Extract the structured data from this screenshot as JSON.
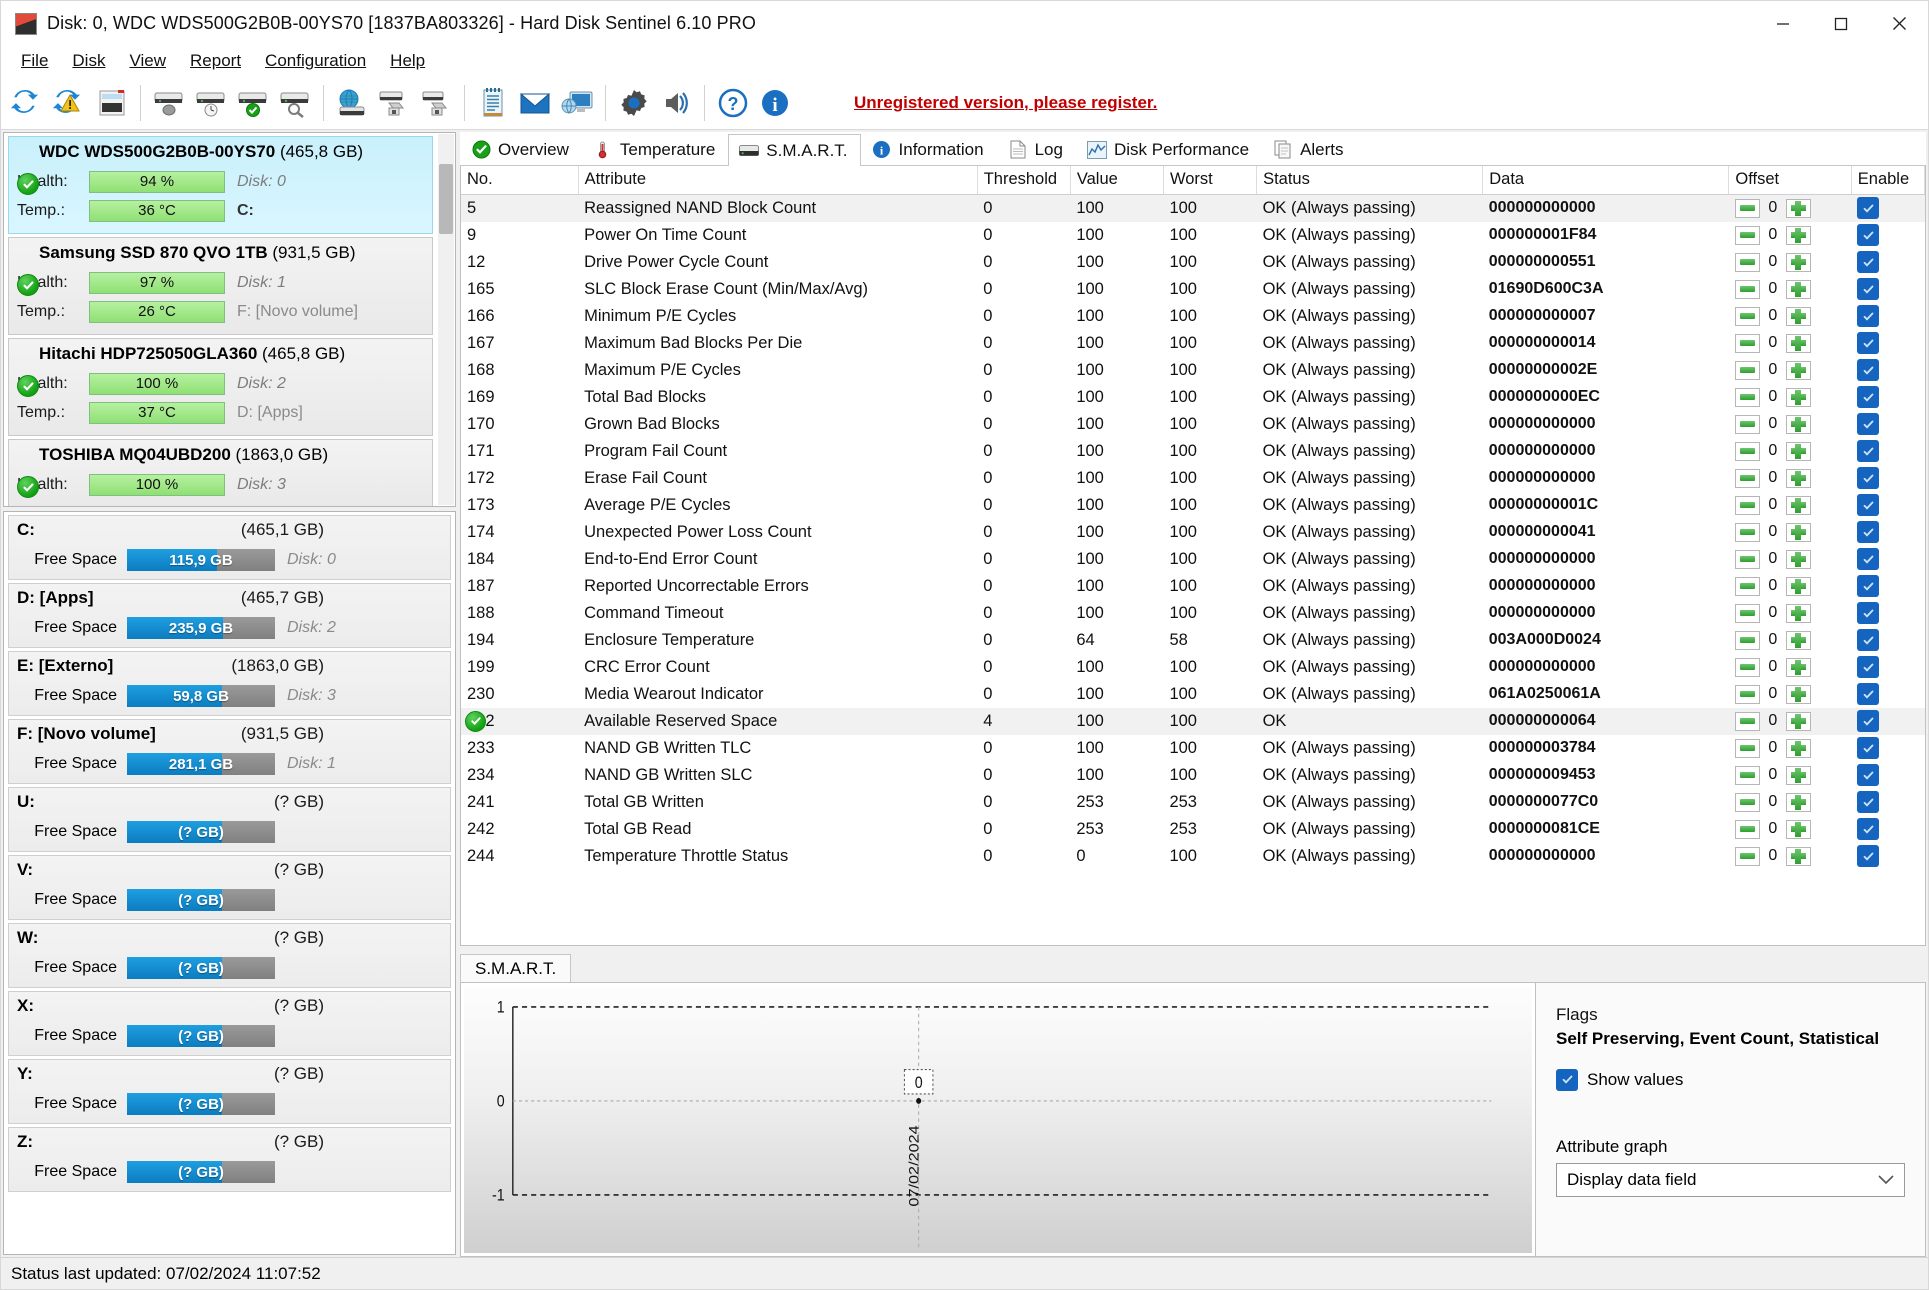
{
  "window": {
    "title": "Disk: 0, WDC WDS500G2B0B-00YS70 [1837BA803326]  -  Hard Disk Sentinel 6.10 PRO",
    "minimize": "—",
    "maximize": "□",
    "close": "✕"
  },
  "menu": [
    {
      "label": "File"
    },
    {
      "label": "Disk"
    },
    {
      "label": "View"
    },
    {
      "label": "Report"
    },
    {
      "label": "Configuration"
    },
    {
      "label": "Help"
    }
  ],
  "toolbar": {
    "registration_notice": "Unregistered version, please register.",
    "buttons": [
      {
        "name": "refresh-icon",
        "title": "Refresh"
      },
      {
        "name": "refresh-warning-icon",
        "title": "Refresh with alert"
      },
      {
        "name": "disk-report-icon",
        "title": "Report"
      },
      {
        "name": "disk-acoustic-icon",
        "title": "Acoustic management"
      },
      {
        "name": "disk-power-icon",
        "title": "Power management"
      },
      {
        "name": "disk-check-icon",
        "title": "Disk check"
      },
      {
        "name": "disk-search-icon",
        "title": "Surface test"
      },
      {
        "name": "network-disk-icon",
        "title": "Network disks"
      },
      {
        "name": "disk-backup-icon",
        "title": "Backup"
      },
      {
        "name": "disk-clone-icon",
        "title": "Clone"
      },
      {
        "name": "notepad-icon",
        "title": "Text report"
      },
      {
        "name": "email-icon",
        "title": "Send e-mail"
      },
      {
        "name": "remote-monitor-icon",
        "title": "Remote monitoring"
      },
      {
        "name": "gear-icon",
        "title": "Configuration"
      },
      {
        "name": "alert-sound-icon",
        "title": "Alerts"
      },
      {
        "name": "help-icon",
        "title": "Help"
      },
      {
        "name": "info-icon",
        "title": "Information"
      }
    ]
  },
  "disks": [
    {
      "name": "WDC WDS500G2B0B-00YS70",
      "capacity": "(465,8 GB)",
      "health_label": "Health:",
      "health_value": "94 %",
      "temp_label": "Temp.:",
      "temp_value": "36 °C",
      "disk_no": "Disk: 0",
      "volumes": "C:",
      "selected": true
    },
    {
      "name": "Samsung SSD 870 QVO 1TB",
      "capacity": "(931,5 GB)",
      "health_label": "Health:",
      "health_value": "97 %",
      "temp_label": "Temp.:",
      "temp_value": "26 °C",
      "disk_no": "Disk: 1",
      "volumes": "F: [Novo volume]",
      "selected": false
    },
    {
      "name": "Hitachi HDP725050GLA360",
      "capacity": "(465,8 GB)",
      "health_label": "Health:",
      "health_value": "100 %",
      "temp_label": "Temp.:",
      "temp_value": "37 °C",
      "disk_no": "Disk: 2",
      "volumes": "D: [Apps]",
      "selected": false
    },
    {
      "name": "TOSHIBA MQ04UBD200",
      "capacity": "(1863,0 GB)",
      "health_label": "Health:",
      "health_value": "100 %",
      "temp_label": "",
      "temp_value": "",
      "disk_no": "Disk: 3",
      "volumes": "",
      "selected": false
    }
  ],
  "volumes": [
    {
      "letter": "C:",
      "size": "(465,1 GB)",
      "free_label": "Free Space",
      "free": "115,9 GB",
      "pct": 61,
      "disk": "Disk: 0"
    },
    {
      "letter": "D: [Apps]",
      "size": "(465,7 GB)",
      "free_label": "Free Space",
      "free": "235,9 GB",
      "pct": 65,
      "disk": "Disk: 2"
    },
    {
      "letter": "E: [Externo]",
      "size": "(1863,0 GB)",
      "free_label": "Free Space",
      "free": "59,8 GB",
      "pct": 64,
      "disk": "Disk: 3"
    },
    {
      "letter": "F: [Novo volume]",
      "size": "(931,5 GB)",
      "free_label": "Free Space",
      "free": "281,1 GB",
      "pct": 64,
      "disk": "Disk: 1"
    },
    {
      "letter": "U:",
      "size": "(? GB)",
      "free_label": "Free Space",
      "free": "(? GB)",
      "pct": 64,
      "disk": ""
    },
    {
      "letter": "V:",
      "size": "(? GB)",
      "free_label": "Free Space",
      "free": "(? GB)",
      "pct": 64,
      "disk": ""
    },
    {
      "letter": "W:",
      "size": "(? GB)",
      "free_label": "Free Space",
      "free": "(? GB)",
      "pct": 64,
      "disk": ""
    },
    {
      "letter": "X:",
      "size": "(? GB)",
      "free_label": "Free Space",
      "free": "(? GB)",
      "pct": 64,
      "disk": ""
    },
    {
      "letter": "Y:",
      "size": "(? GB)",
      "free_label": "Free Space",
      "free": "(? GB)",
      "pct": 64,
      "disk": ""
    },
    {
      "letter": "Z:",
      "size": "(? GB)",
      "free_label": "Free Space",
      "free": "(? GB)",
      "pct": 64,
      "disk": ""
    }
  ],
  "tabs": [
    {
      "label": "Overview",
      "icon": "check-circle-icon",
      "active": false
    },
    {
      "label": "Temperature",
      "icon": "thermometer-icon",
      "active": false
    },
    {
      "label": "S.M.A.R.T.",
      "icon": "disk-icon",
      "active": true
    },
    {
      "label": "Information",
      "icon": "info-circle-icon",
      "active": false
    },
    {
      "label": "Log",
      "icon": "document-icon",
      "active": false
    },
    {
      "label": "Disk Performance",
      "icon": "chart-icon",
      "active": false
    },
    {
      "label": "Alerts",
      "icon": "copy-icon",
      "active": false
    }
  ],
  "table": {
    "columns": [
      "No.",
      "Attribute",
      "Threshold",
      "Value",
      "Worst",
      "Status",
      "Data",
      "Offset",
      "Enable"
    ],
    "rows": [
      {
        "no": "5",
        "attribute": "Reassigned NAND Block Count",
        "threshold": "0",
        "value": "100",
        "worst": "100",
        "status": "OK (Always passing)",
        "data": "000000000000",
        "offset": "0",
        "enable": true,
        "ok_icon": false,
        "highlight": true
      },
      {
        "no": "9",
        "attribute": "Power On Time Count",
        "threshold": "0",
        "value": "100",
        "worst": "100",
        "status": "OK (Always passing)",
        "data": "000000001F84",
        "offset": "0",
        "enable": true,
        "ok_icon": false,
        "highlight": false
      },
      {
        "no": "12",
        "attribute": "Drive Power Cycle Count",
        "threshold": "0",
        "value": "100",
        "worst": "100",
        "status": "OK (Always passing)",
        "data": "000000000551",
        "offset": "0",
        "enable": true,
        "ok_icon": false,
        "highlight": false
      },
      {
        "no": "165",
        "attribute": "SLC Block Erase Count (Min/Max/Avg)",
        "threshold": "0",
        "value": "100",
        "worst": "100",
        "status": "OK (Always passing)",
        "data": "01690D600C3A",
        "offset": "0",
        "enable": true,
        "ok_icon": false,
        "highlight": false
      },
      {
        "no": "166",
        "attribute": "Minimum P/E Cycles",
        "threshold": "0",
        "value": "100",
        "worst": "100",
        "status": "OK (Always passing)",
        "data": "000000000007",
        "offset": "0",
        "enable": true,
        "ok_icon": false,
        "highlight": false
      },
      {
        "no": "167",
        "attribute": "Maximum Bad Blocks Per Die",
        "threshold": "0",
        "value": "100",
        "worst": "100",
        "status": "OK (Always passing)",
        "data": "000000000014",
        "offset": "0",
        "enable": true,
        "ok_icon": false,
        "highlight": false
      },
      {
        "no": "168",
        "attribute": "Maximum P/E Cycles",
        "threshold": "0",
        "value": "100",
        "worst": "100",
        "status": "OK (Always passing)",
        "data": "00000000002E",
        "offset": "0",
        "enable": true,
        "ok_icon": false,
        "highlight": false
      },
      {
        "no": "169",
        "attribute": "Total Bad Blocks",
        "threshold": "0",
        "value": "100",
        "worst": "100",
        "status": "OK (Always passing)",
        "data": "0000000000EC",
        "offset": "0",
        "enable": true,
        "ok_icon": false,
        "highlight": false
      },
      {
        "no": "170",
        "attribute": "Grown Bad Blocks",
        "threshold": "0",
        "value": "100",
        "worst": "100",
        "status": "OK (Always passing)",
        "data": "000000000000",
        "offset": "0",
        "enable": true,
        "ok_icon": false,
        "highlight": false
      },
      {
        "no": "171",
        "attribute": "Program Fail Count",
        "threshold": "0",
        "value": "100",
        "worst": "100",
        "status": "OK (Always passing)",
        "data": "000000000000",
        "offset": "0",
        "enable": true,
        "ok_icon": false,
        "highlight": false
      },
      {
        "no": "172",
        "attribute": "Erase Fail Count",
        "threshold": "0",
        "value": "100",
        "worst": "100",
        "status": "OK (Always passing)",
        "data": "000000000000",
        "offset": "0",
        "enable": true,
        "ok_icon": false,
        "highlight": false
      },
      {
        "no": "173",
        "attribute": "Average P/E Cycles",
        "threshold": "0",
        "value": "100",
        "worst": "100",
        "status": "OK (Always passing)",
        "data": "00000000001C",
        "offset": "0",
        "enable": true,
        "ok_icon": false,
        "highlight": false
      },
      {
        "no": "174",
        "attribute": "Unexpected Power Loss Count",
        "threshold": "0",
        "value": "100",
        "worst": "100",
        "status": "OK (Always passing)",
        "data": "000000000041",
        "offset": "0",
        "enable": true,
        "ok_icon": false,
        "highlight": false
      },
      {
        "no": "184",
        "attribute": "End-to-End Error Count",
        "threshold": "0",
        "value": "100",
        "worst": "100",
        "status": "OK (Always passing)",
        "data": "000000000000",
        "offset": "0",
        "enable": true,
        "ok_icon": false,
        "highlight": false
      },
      {
        "no": "187",
        "attribute": "Reported Uncorrectable Errors",
        "threshold": "0",
        "value": "100",
        "worst": "100",
        "status": "OK (Always passing)",
        "data": "000000000000",
        "offset": "0",
        "enable": true,
        "ok_icon": false,
        "highlight": false
      },
      {
        "no": "188",
        "attribute": "Command Timeout",
        "threshold": "0",
        "value": "100",
        "worst": "100",
        "status": "OK (Always passing)",
        "data": "000000000000",
        "offset": "0",
        "enable": true,
        "ok_icon": false,
        "highlight": false
      },
      {
        "no": "194",
        "attribute": "Enclosure Temperature",
        "threshold": "0",
        "value": "64",
        "worst": "58",
        "status": "OK (Always passing)",
        "data": "003A000D0024",
        "offset": "0",
        "enable": true,
        "ok_icon": false,
        "highlight": false
      },
      {
        "no": "199",
        "attribute": "CRC Error Count",
        "threshold": "0",
        "value": "100",
        "worst": "100",
        "status": "OK (Always passing)",
        "data": "000000000000",
        "offset": "0",
        "enable": true,
        "ok_icon": false,
        "highlight": false
      },
      {
        "no": "230",
        "attribute": "Media Wearout Indicator",
        "threshold": "0",
        "value": "100",
        "worst": "100",
        "status": "OK (Always passing)",
        "data": "061A0250061A",
        "offset": "0",
        "enable": true,
        "ok_icon": false,
        "highlight": false
      },
      {
        "no": "232",
        "attribute": "Available Reserved Space",
        "threshold": "4",
        "value": "100",
        "worst": "100",
        "status": "OK",
        "data": "000000000064",
        "offset": "0",
        "enable": true,
        "ok_icon": true,
        "highlight": true
      },
      {
        "no": "233",
        "attribute": "NAND GB Written TLC",
        "threshold": "0",
        "value": "100",
        "worst": "100",
        "status": "OK (Always passing)",
        "data": "000000003784",
        "offset": "0",
        "enable": true,
        "ok_icon": false,
        "highlight": false
      },
      {
        "no": "234",
        "attribute": "NAND GB Written SLC",
        "threshold": "0",
        "value": "100",
        "worst": "100",
        "status": "OK (Always passing)",
        "data": "000000009453",
        "offset": "0",
        "enable": true,
        "ok_icon": false,
        "highlight": false
      },
      {
        "no": "241",
        "attribute": "Total GB Written",
        "threshold": "0",
        "value": "253",
        "worst": "253",
        "status": "OK (Always passing)",
        "data": "0000000077C0",
        "offset": "0",
        "enable": true,
        "ok_icon": false,
        "highlight": false
      },
      {
        "no": "242",
        "attribute": "Total GB Read",
        "threshold": "0",
        "value": "253",
        "worst": "253",
        "status": "OK (Always passing)",
        "data": "0000000081CE",
        "offset": "0",
        "enable": true,
        "ok_icon": false,
        "highlight": false
      },
      {
        "no": "244",
        "attribute": "Temperature Throttle Status",
        "threshold": "0",
        "value": "0",
        "worst": "100",
        "status": "OK (Always passing)",
        "data": "000000000000",
        "offset": "0",
        "enable": true,
        "ok_icon": false,
        "highlight": false
      }
    ]
  },
  "graph": {
    "tab_label": "S.M.A.R.T.",
    "flags_label": "Flags",
    "flags_value": "Self Preserving, Event Count, Statistical",
    "show_values_label": "Show values",
    "show_values_checked": true,
    "attribute_graph_label": "Attribute graph",
    "attribute_graph_value": "Display data field"
  },
  "chart_data": {
    "type": "line",
    "title": "S.M.A.R.T.",
    "x": [
      "07/02/2024"
    ],
    "values": [
      0
    ],
    "point_labels": [
      "0"
    ],
    "yticks": [
      "1",
      "0",
      "-1"
    ],
    "ylim": [
      -1,
      1
    ],
    "xlabel": "",
    "ylabel": "",
    "grid": true,
    "legend": "none"
  },
  "statusbar": {
    "text": "Status last updated: 07/02/2024 11:07:52"
  }
}
